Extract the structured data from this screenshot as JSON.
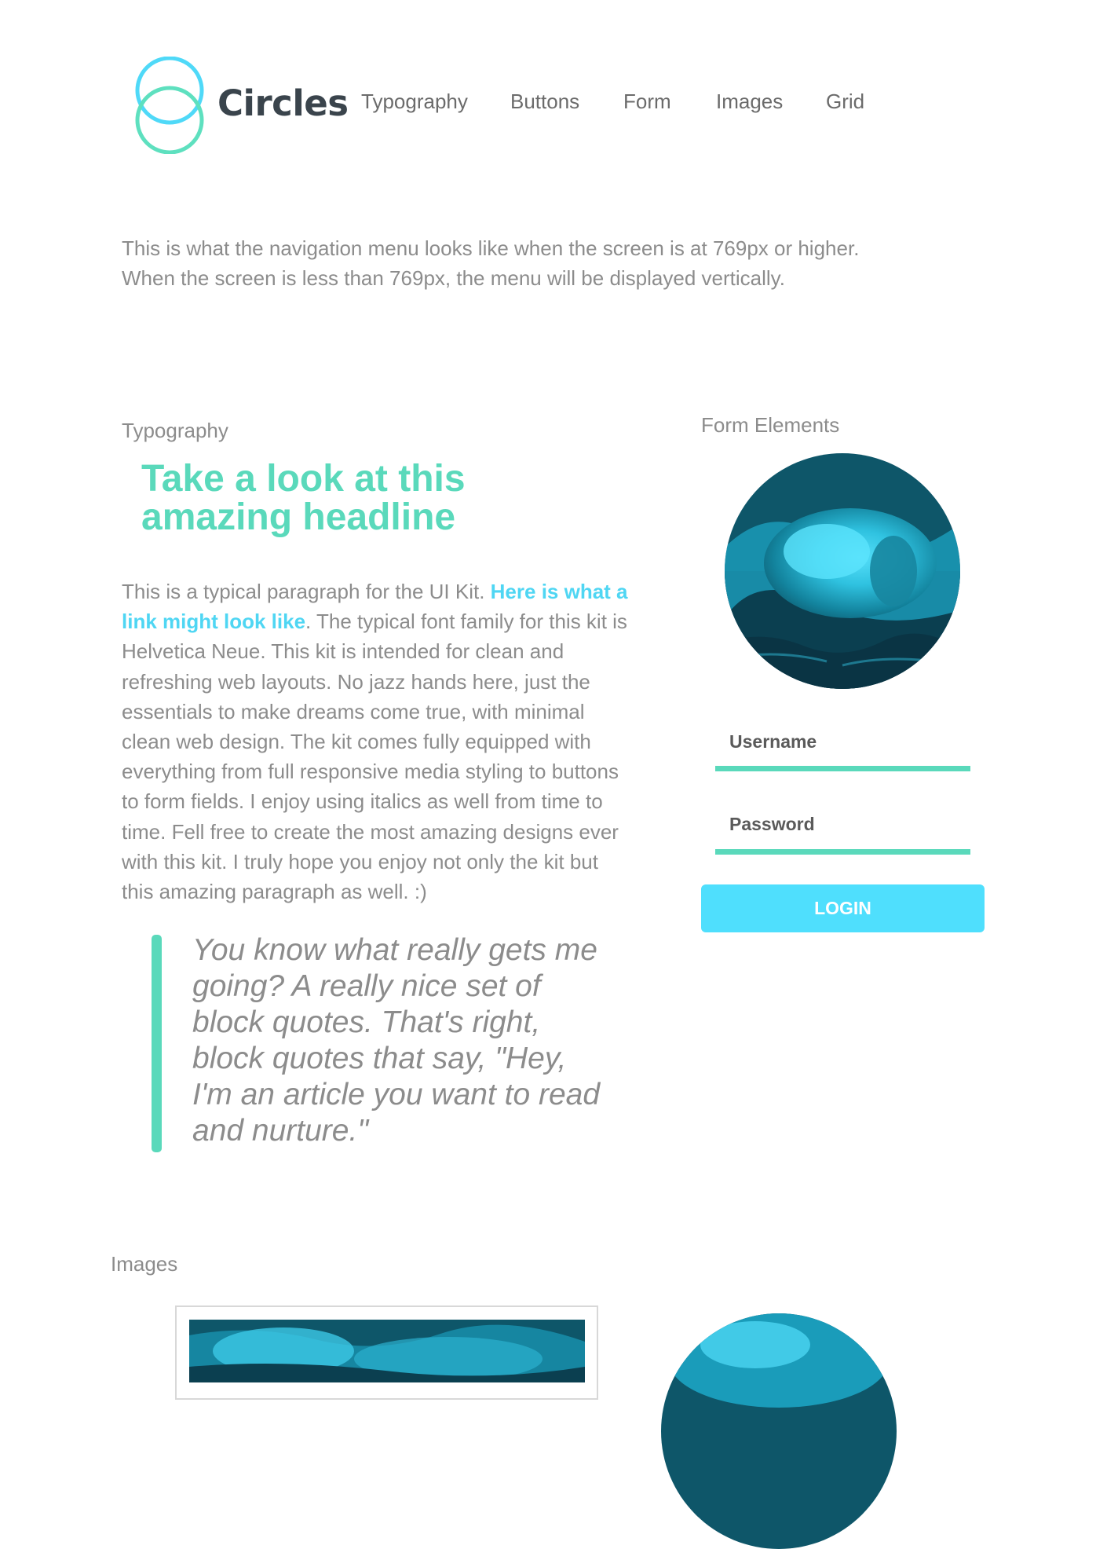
{
  "header": {
    "brand": "Circles",
    "logo_icon": "two-overlapping-circles-icon",
    "nav": [
      {
        "label": "Typography"
      },
      {
        "label": "Buttons"
      },
      {
        "label": "Form"
      },
      {
        "label": "Images"
      },
      {
        "label": "Grid"
      }
    ]
  },
  "intro": "This is what the navigation menu looks like when the screen is at 769px or higher. When the screen is less than 769px, the menu will be displayed vertically.",
  "typography": {
    "label": "Typography",
    "headline": "Take a look at this amazing headline",
    "paragraph_before": "This is a typical paragraph for the UI Kit. ",
    "link_text": "Here is what a link might look like",
    "paragraph_after": ". The typical font family for this kit is Helvetica Neue. This kit is intended for clean and refreshing web layouts. No jazz hands here, just the essentials to make dreams come true, with minimal clean web design. The kit comes fully equipped with everything from full responsive media styling to buttons to form fields. I enjoy using italics as well from time to time. Fell free to create the most amazing designs ever with this kit. I truly hope you enjoy not only the kit but this amazing paragraph as well. :)",
    "blockquote": "You know what really gets me going? A really nice set of block quotes. That's right, block quotes that say, \"Hey, I'm an article you want to read and nurture.\""
  },
  "form": {
    "label": "Form Elements",
    "username_label": "Username",
    "password_label": "Password",
    "login_label": "LOGIN"
  },
  "images": {
    "label": "Images"
  },
  "colors": {
    "accent_green": "#5ad9bb",
    "accent_cyan": "#4fdffd",
    "link": "#4fd6f3",
    "text": "#8c8c8c",
    "brand_text": "#3a444c"
  }
}
